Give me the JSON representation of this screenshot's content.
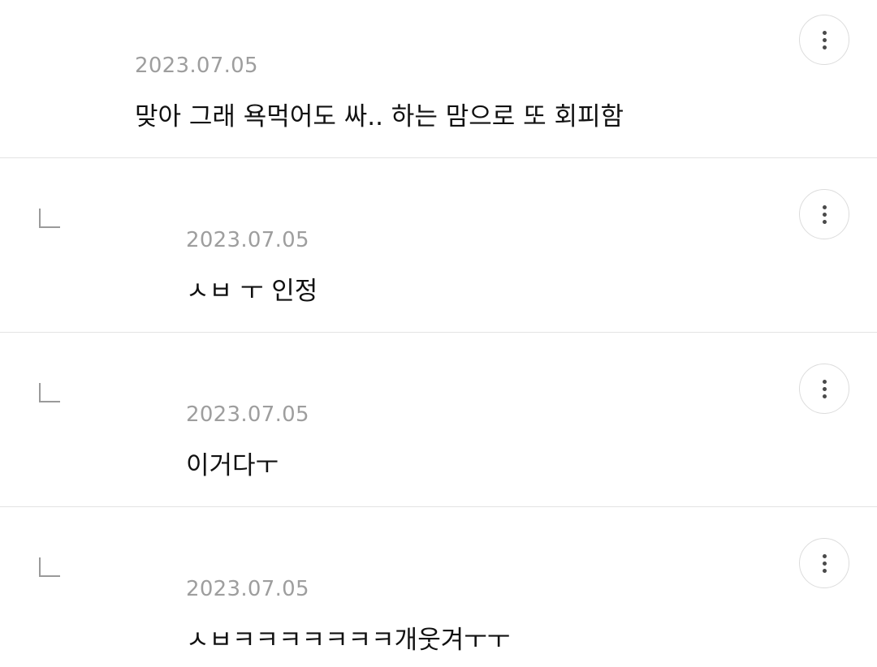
{
  "comments": [
    {
      "date": "2023.07.05",
      "text": "맞아 그래 욕먹어도 싸.. 하는 맘으로 또 회피함",
      "is_reply": false,
      "more_icon": "more-vertical-icon"
    },
    {
      "date": "2023.07.05",
      "text": "ㅅㅂ ㅜ 인정",
      "is_reply": true,
      "more_icon": "more-vertical-icon"
    },
    {
      "date": "2023.07.05",
      "text": "이거다ㅜ",
      "is_reply": true,
      "more_icon": "more-vertical-icon"
    },
    {
      "date": "2023.07.05",
      "text": "ㅅㅂㅋㅋㅋㅋㅋㅋㅋ개웃겨ㅜㅜ",
      "is_reply": true,
      "more_icon": "more-vertical-icon"
    }
  ],
  "colors": {
    "date": "#9e9e9e",
    "text": "#111111",
    "divider": "#e3e3e3",
    "reply_mark": "#9a9a9a"
  }
}
